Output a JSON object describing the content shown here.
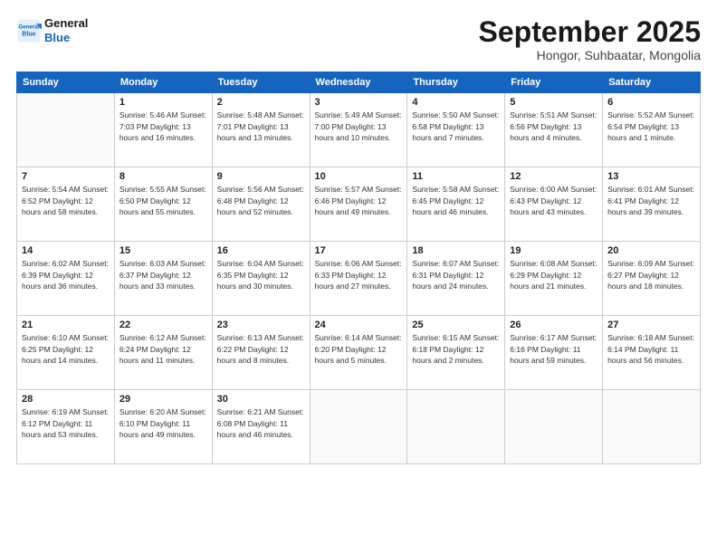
{
  "logo": {
    "line1": "General",
    "line2": "Blue"
  },
  "title": "September 2025",
  "subtitle": "Hongor, Suhbaatar, Mongolia",
  "days_header": [
    "Sunday",
    "Monday",
    "Tuesday",
    "Wednesday",
    "Thursday",
    "Friday",
    "Saturday"
  ],
  "weeks": [
    [
      {
        "day": "",
        "info": ""
      },
      {
        "day": "1",
        "info": "Sunrise: 5:46 AM\nSunset: 7:03 PM\nDaylight: 13 hours\nand 16 minutes."
      },
      {
        "day": "2",
        "info": "Sunrise: 5:48 AM\nSunset: 7:01 PM\nDaylight: 13 hours\nand 13 minutes."
      },
      {
        "day": "3",
        "info": "Sunrise: 5:49 AM\nSunset: 7:00 PM\nDaylight: 13 hours\nand 10 minutes."
      },
      {
        "day": "4",
        "info": "Sunrise: 5:50 AM\nSunset: 6:58 PM\nDaylight: 13 hours\nand 7 minutes."
      },
      {
        "day": "5",
        "info": "Sunrise: 5:51 AM\nSunset: 6:56 PM\nDaylight: 13 hours\nand 4 minutes."
      },
      {
        "day": "6",
        "info": "Sunrise: 5:52 AM\nSunset: 6:54 PM\nDaylight: 13 hours\nand 1 minute."
      }
    ],
    [
      {
        "day": "7",
        "info": "Sunrise: 5:54 AM\nSunset: 6:52 PM\nDaylight: 12 hours\nand 58 minutes."
      },
      {
        "day": "8",
        "info": "Sunrise: 5:55 AM\nSunset: 6:50 PM\nDaylight: 12 hours\nand 55 minutes."
      },
      {
        "day": "9",
        "info": "Sunrise: 5:56 AM\nSunset: 6:48 PM\nDaylight: 12 hours\nand 52 minutes."
      },
      {
        "day": "10",
        "info": "Sunrise: 5:57 AM\nSunset: 6:46 PM\nDaylight: 12 hours\nand 49 minutes."
      },
      {
        "day": "11",
        "info": "Sunrise: 5:58 AM\nSunset: 6:45 PM\nDaylight: 12 hours\nand 46 minutes."
      },
      {
        "day": "12",
        "info": "Sunrise: 6:00 AM\nSunset: 6:43 PM\nDaylight: 12 hours\nand 43 minutes."
      },
      {
        "day": "13",
        "info": "Sunrise: 6:01 AM\nSunset: 6:41 PM\nDaylight: 12 hours\nand 39 minutes."
      }
    ],
    [
      {
        "day": "14",
        "info": "Sunrise: 6:02 AM\nSunset: 6:39 PM\nDaylight: 12 hours\nand 36 minutes."
      },
      {
        "day": "15",
        "info": "Sunrise: 6:03 AM\nSunset: 6:37 PM\nDaylight: 12 hours\nand 33 minutes."
      },
      {
        "day": "16",
        "info": "Sunrise: 6:04 AM\nSunset: 6:35 PM\nDaylight: 12 hours\nand 30 minutes."
      },
      {
        "day": "17",
        "info": "Sunrise: 6:06 AM\nSunset: 6:33 PM\nDaylight: 12 hours\nand 27 minutes."
      },
      {
        "day": "18",
        "info": "Sunrise: 6:07 AM\nSunset: 6:31 PM\nDaylight: 12 hours\nand 24 minutes."
      },
      {
        "day": "19",
        "info": "Sunrise: 6:08 AM\nSunset: 6:29 PM\nDaylight: 12 hours\nand 21 minutes."
      },
      {
        "day": "20",
        "info": "Sunrise: 6:09 AM\nSunset: 6:27 PM\nDaylight: 12 hours\nand 18 minutes."
      }
    ],
    [
      {
        "day": "21",
        "info": "Sunrise: 6:10 AM\nSunset: 6:25 PM\nDaylight: 12 hours\nand 14 minutes."
      },
      {
        "day": "22",
        "info": "Sunrise: 6:12 AM\nSunset: 6:24 PM\nDaylight: 12 hours\nand 11 minutes."
      },
      {
        "day": "23",
        "info": "Sunrise: 6:13 AM\nSunset: 6:22 PM\nDaylight: 12 hours\nand 8 minutes."
      },
      {
        "day": "24",
        "info": "Sunrise: 6:14 AM\nSunset: 6:20 PM\nDaylight: 12 hours\nand 5 minutes."
      },
      {
        "day": "25",
        "info": "Sunrise: 6:15 AM\nSunset: 6:18 PM\nDaylight: 12 hours\nand 2 minutes."
      },
      {
        "day": "26",
        "info": "Sunrise: 6:17 AM\nSunset: 6:16 PM\nDaylight: 11 hours\nand 59 minutes."
      },
      {
        "day": "27",
        "info": "Sunrise: 6:18 AM\nSunset: 6:14 PM\nDaylight: 11 hours\nand 56 minutes."
      }
    ],
    [
      {
        "day": "28",
        "info": "Sunrise: 6:19 AM\nSunset: 6:12 PM\nDaylight: 11 hours\nand 53 minutes."
      },
      {
        "day": "29",
        "info": "Sunrise: 6:20 AM\nSunset: 6:10 PM\nDaylight: 11 hours\nand 49 minutes."
      },
      {
        "day": "30",
        "info": "Sunrise: 6:21 AM\nSunset: 6:08 PM\nDaylight: 11 hours\nand 46 minutes."
      },
      {
        "day": "",
        "info": ""
      },
      {
        "day": "",
        "info": ""
      },
      {
        "day": "",
        "info": ""
      },
      {
        "day": "",
        "info": ""
      }
    ]
  ]
}
